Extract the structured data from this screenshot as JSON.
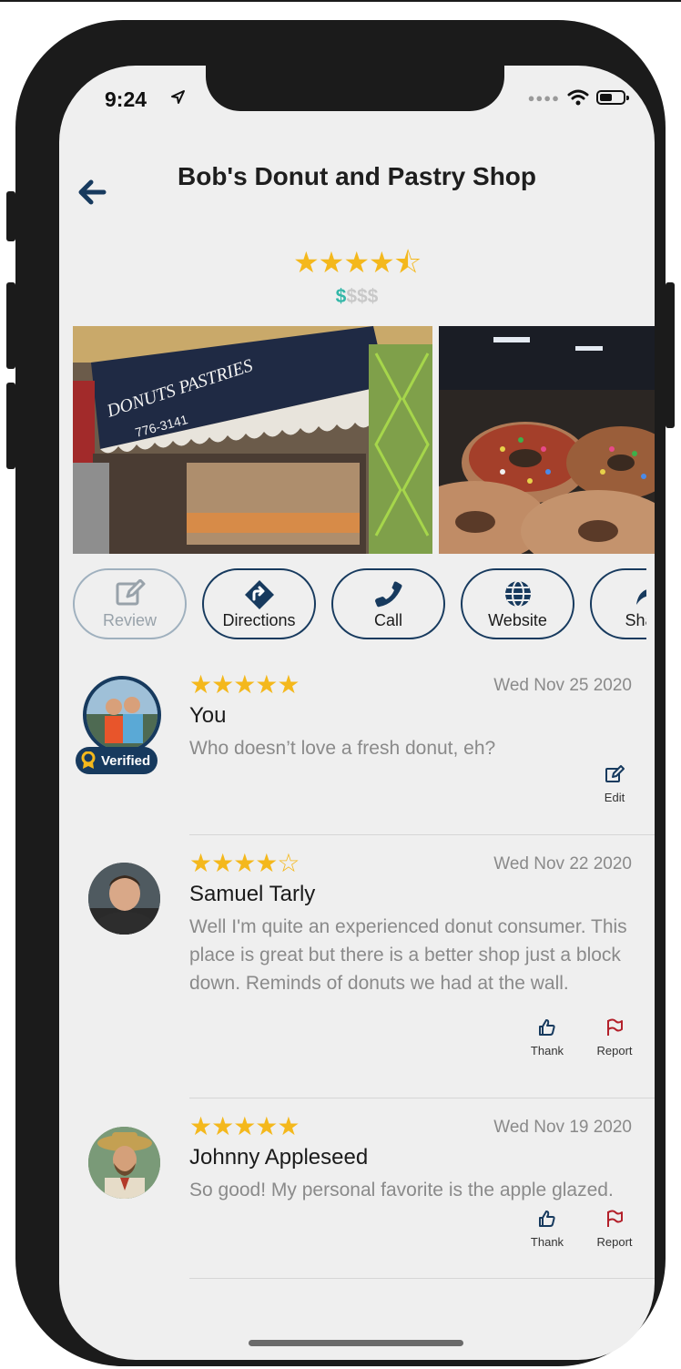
{
  "status": {
    "time": "9:24"
  },
  "header": {
    "title": "Bob's Donut and Pastry Shop",
    "rating_stars": "★★★★⯪",
    "price_on": "$",
    "price_off": "$$$"
  },
  "actions": [
    {
      "label": "Review",
      "icon": "edit-icon",
      "enabled": false
    },
    {
      "label": "Directions",
      "icon": "directions-icon",
      "enabled": true
    },
    {
      "label": "Call",
      "icon": "phone-icon",
      "enabled": true
    },
    {
      "label": "Website",
      "icon": "globe-icon",
      "enabled": true
    },
    {
      "label": "Share",
      "icon": "share-icon",
      "enabled": true
    }
  ],
  "reviews": [
    {
      "stars": "★★★★★",
      "date": "Wed Nov 25 2020",
      "name": "You",
      "text": "Who doesn’t love a fresh donut, eh?",
      "badge": "Verified",
      "edit_label": "Edit"
    },
    {
      "stars": "★★★★☆",
      "date": "Wed Nov 22 2020",
      "name": "Samuel Tarly",
      "text": "Well I'm quite an experienced donut consumer. This place is great but there is a better shop just a block down. Reminds of donuts we had at the wall.",
      "thank_label": "Thank",
      "report_label": "Report"
    },
    {
      "stars": "★★★★★",
      "date": "Wed Nov 19 2020",
      "name": "Johnny Appleseed",
      "text": "So good! My personal favorite is the apple glazed.",
      "thank_label": "Thank",
      "report_label": "Report"
    }
  ],
  "colors": {
    "accent": "#173a5e",
    "star": "#f4b81c",
    "price": "#33b7a8",
    "report": "#b3202a"
  }
}
